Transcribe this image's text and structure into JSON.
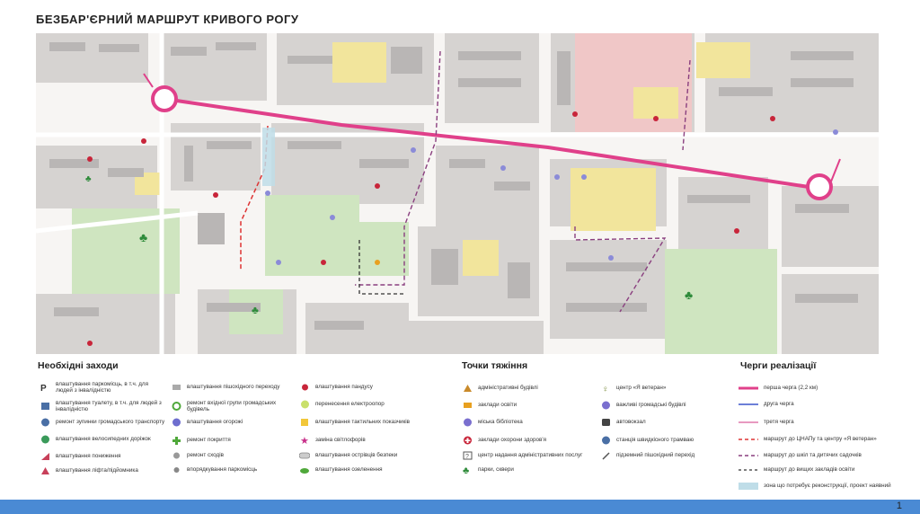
{
  "title": "БЕЗБАР'ЄРНИЙ МАРШРУТ КРИВОГО РОГУ",
  "colors": {
    "route_main": "#e0408a",
    "route_second": "#6c7fd8",
    "route_third": "#e899c0",
    "block": "#cfcccb",
    "building": "#b9b6b5",
    "park": "#cfe5c0",
    "yellow": "#f2e59c",
    "pink": "#f0c7c7",
    "road": "#f7f5f3"
  },
  "legend": {
    "measures": {
      "heading": "Необхідні заходи",
      "col1": [
        {
          "icon": "parking-disabled-icon",
          "label": "влаштування паркомісць, в т.ч. для людей з інвалідністю"
        },
        {
          "icon": "toilet-icon",
          "label": "влаштування туалету, в т.ч. для людей з інвалідністю"
        },
        {
          "icon": "bus-stop-icon",
          "label": "ремонт зупинки громадського транспорту"
        },
        {
          "icon": "bike-path-icon",
          "label": "влаштування велосипедних доріжок"
        },
        {
          "icon": "curb-lowering-icon",
          "label": "влаштування пониження"
        },
        {
          "icon": "lift-icon",
          "label": "влаштування ліфта/підйомника"
        }
      ],
      "col2": [
        {
          "icon": "crosswalk-icon",
          "label": "влаштування пішохідного переходу"
        },
        {
          "icon": "entrance-repair-icon",
          "label": "ремонт вхідної групи громадських будівель"
        },
        {
          "icon": "fence-icon",
          "label": "влаштування огорожі"
        },
        {
          "icon": "surface-repair-icon",
          "label": "ремонт покриття"
        },
        {
          "icon": "stairs-repair-icon",
          "label": "ремонт сходів"
        },
        {
          "icon": "parking-order-icon",
          "label": "впорядкування паркомісць"
        }
      ],
      "col3": [
        {
          "icon": "ramp-icon",
          "label": "влаштування пандусу"
        },
        {
          "icon": "pole-relocation-icon",
          "label": "перенесення електроопор"
        },
        {
          "icon": "tactile-icon",
          "label": "влаштування тактильних показчиків"
        },
        {
          "icon": "traffic-light-icon",
          "label": "заміна світлофорів"
        },
        {
          "icon": "safety-island-icon",
          "label": "влаштування острівців безпеки"
        },
        {
          "icon": "greening-icon",
          "label": "влаштування озеленення"
        }
      ]
    },
    "attractions": {
      "heading": "Точки тяжіння",
      "col1": [
        {
          "icon": "admin-building-icon",
          "label": "адміністративні будівлі"
        },
        {
          "icon": "education-icon",
          "label": "заклади освіти"
        },
        {
          "icon": "library-icon",
          "label": "міська бібліотека"
        },
        {
          "icon": "health-icon",
          "label": "заклади охорони здоров'я"
        },
        {
          "icon": "cnap-icon",
          "label": "центр надання адміністративних послуг"
        },
        {
          "icon": "park-icon",
          "label": "парки, сквери"
        }
      ],
      "col2": [
        {
          "icon": "veteran-center-icon",
          "label": "центр «Я ветеран»"
        },
        {
          "icon": "public-building-icon",
          "label": "важливі громадські будівлі"
        },
        {
          "icon": "bus-station-icon",
          "label": "автовокзал"
        },
        {
          "icon": "tram-icon",
          "label": "станція швидкісного трамваю"
        },
        {
          "icon": "underpass-icon",
          "label": "підземний пішохідний перехід"
        }
      ]
    },
    "phases": {
      "heading": "Черги реалізації",
      "items": [
        {
          "style": "main",
          "label": "перша черга (2,2 км)"
        },
        {
          "style": "second",
          "label": "друга черга"
        },
        {
          "style": "third",
          "label": "третя черга"
        },
        {
          "style": "dash-red",
          "label": "маршрут до ЦНАПу та центру «Я ветеран»"
        },
        {
          "style": "dash-purple",
          "label": "маршрут до шкіл та дитячих садочків"
        },
        {
          "style": "dash-dark",
          "label": "маршрут до вищих закладів освіти"
        },
        {
          "style": "zone",
          "label": "зона що потребує реконструкції, проект наявний"
        }
      ]
    }
  },
  "page_number": "1"
}
